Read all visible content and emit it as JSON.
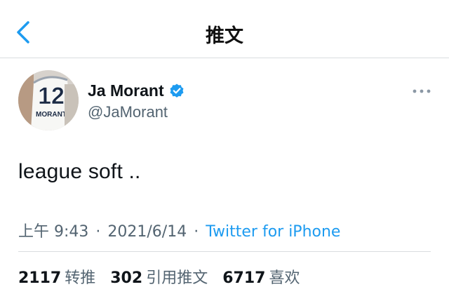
{
  "header": {
    "title": "推文"
  },
  "tweet": {
    "author_name": "Ja Morant",
    "handle": "@JaMorant",
    "avatar_jersey_number": "12",
    "avatar_jersey_name": "MORANT",
    "text": "league soft ..",
    "time": "上午 9:43",
    "date": "2021/6/14",
    "source": "Twitter for iPhone",
    "separator": "·"
  },
  "stats": [
    {
      "count": "2117",
      "label": "转推"
    },
    {
      "count": "302",
      "label": "引用推文"
    },
    {
      "count": "6717",
      "label": "喜欢"
    }
  ],
  "colors": {
    "accent": "#1d9bf0",
    "secondary_text": "#536471",
    "verified": "#1d9bf0"
  }
}
